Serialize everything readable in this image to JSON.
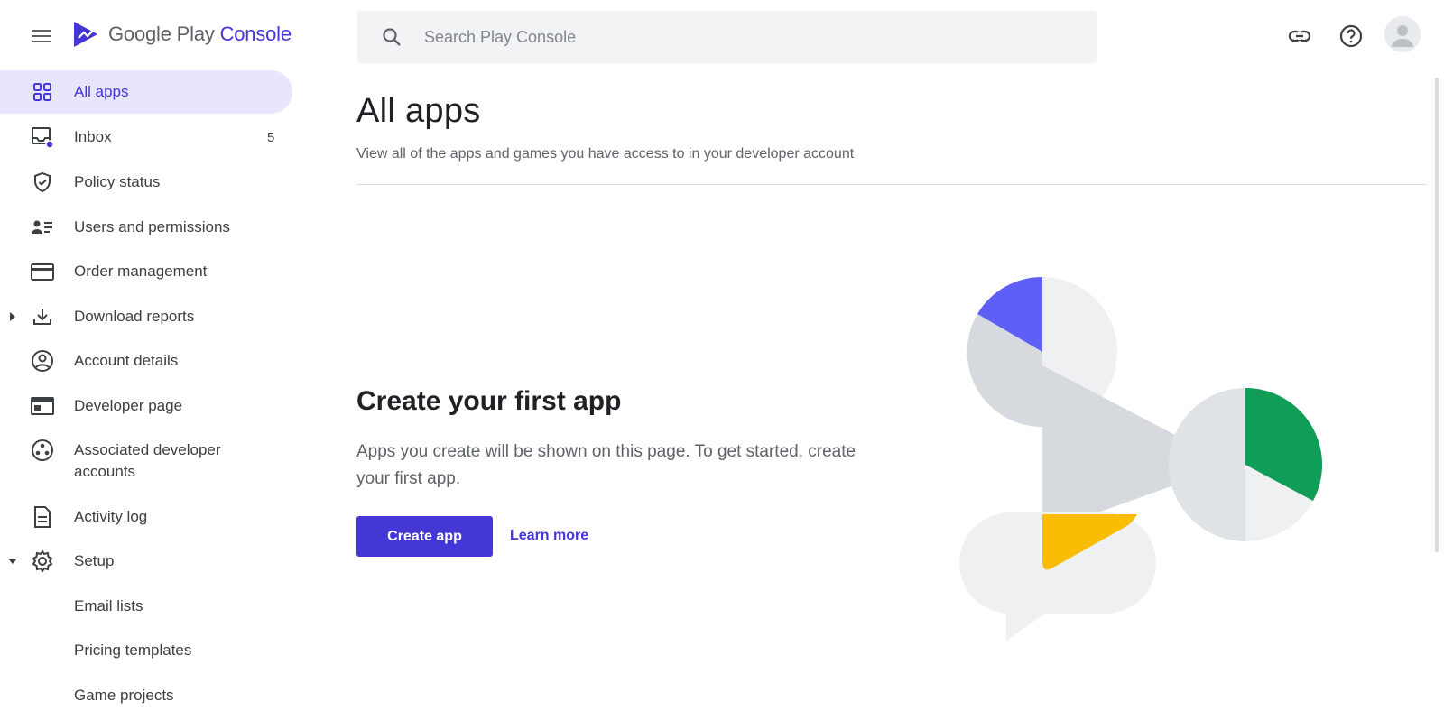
{
  "topbar": {
    "logo_google_play": "Google Play",
    "logo_console": "Console",
    "search_placeholder": "Search Play Console"
  },
  "sidebar": {
    "items": [
      {
        "label": "All apps",
        "icon": "grid-icon",
        "active": true
      },
      {
        "label": "Inbox",
        "icon": "inbox-icon",
        "badge": "5"
      },
      {
        "label": "Policy status",
        "icon": "shield-check-icon"
      },
      {
        "label": "Users and permissions",
        "icon": "users-list-icon"
      },
      {
        "label": "Order management",
        "icon": "credit-card-icon"
      },
      {
        "label": "Download reports",
        "icon": "download-icon",
        "expandable": true
      },
      {
        "label": "Account details",
        "icon": "account-circle-icon"
      },
      {
        "label": "Developer page",
        "icon": "web-page-icon"
      },
      {
        "label": "Associated developer accounts",
        "icon": "linked-accounts-icon"
      },
      {
        "label": "Activity log",
        "icon": "document-icon"
      },
      {
        "label": "Setup",
        "icon": "gear-icon",
        "expanded": true
      },
      {
        "label": "Email lists"
      },
      {
        "label": "Pricing templates"
      },
      {
        "label": "Game projects"
      }
    ]
  },
  "main": {
    "title": "All apps",
    "subtitle": "View all of the apps and games you have access to in your developer account",
    "empty_title": "Create your first app",
    "empty_description": "Apps you create will be shown on this page. To get started, create your first app.",
    "create_button": "Create app",
    "learn_more": "Learn more"
  },
  "colors": {
    "accent": "#4536d6",
    "active_bg": "#e8e6fc",
    "green": "#0f9d58",
    "yellow": "#fbbc04",
    "blue_slice": "#5e5ff7"
  }
}
